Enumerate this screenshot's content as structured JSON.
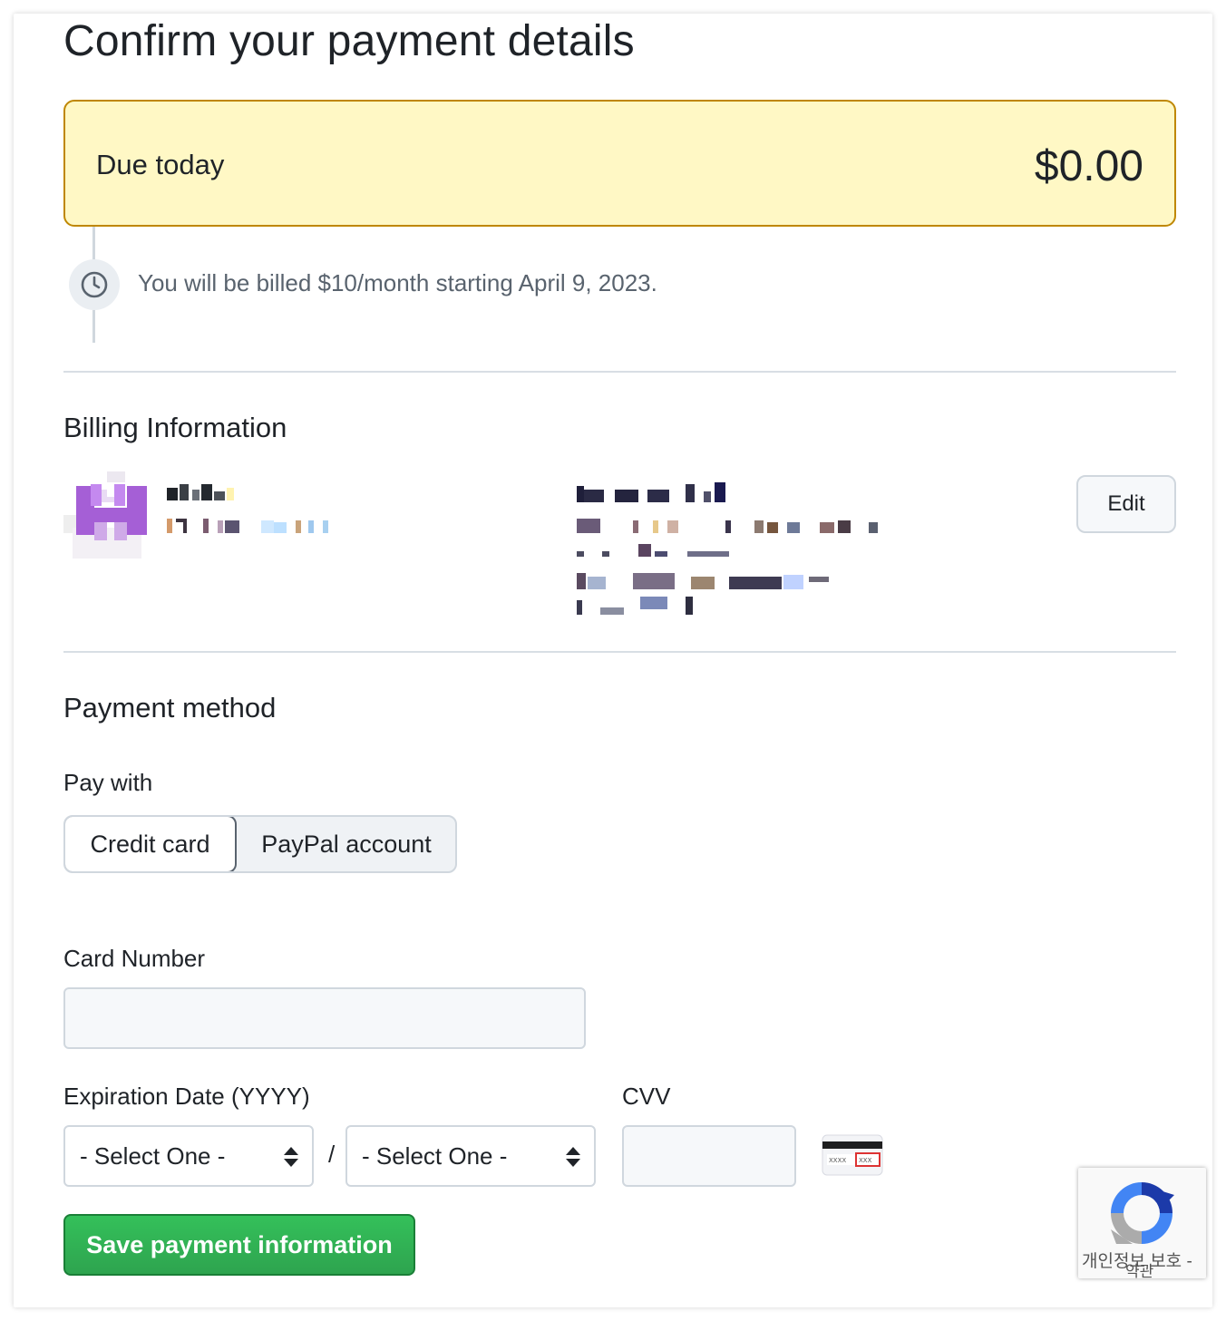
{
  "page": {
    "title": "Confirm your payment details"
  },
  "due": {
    "label": "Due today",
    "amount": "$0.00"
  },
  "billing_notice": "You will be billed $10/month starting April 9, 2023.",
  "billing_info": {
    "heading": "Billing Information",
    "edit_label": "Edit"
  },
  "payment_method": {
    "heading": "Payment method",
    "pay_with_label": "Pay with",
    "options": [
      "Credit card",
      "PayPal account"
    ],
    "selected": "Credit card"
  },
  "card_form": {
    "card_number_label": "Card Number",
    "card_number_value": "",
    "expiration_label": "Expiration Date (YYYY)",
    "month_select": "- Select One -",
    "year_select": "- Select One -",
    "separator": "/",
    "cvv_label": "CVV",
    "cvv_value": "",
    "save_label": "Save payment information"
  },
  "recaptcha": {
    "line1": "개인정보 보호 -",
    "line2": "약관"
  },
  "colors": {
    "due_background": "#fff8c5",
    "due_border": "#bf8700",
    "save_button": "#2da44e",
    "avatar_purple": "#a55fd6"
  }
}
